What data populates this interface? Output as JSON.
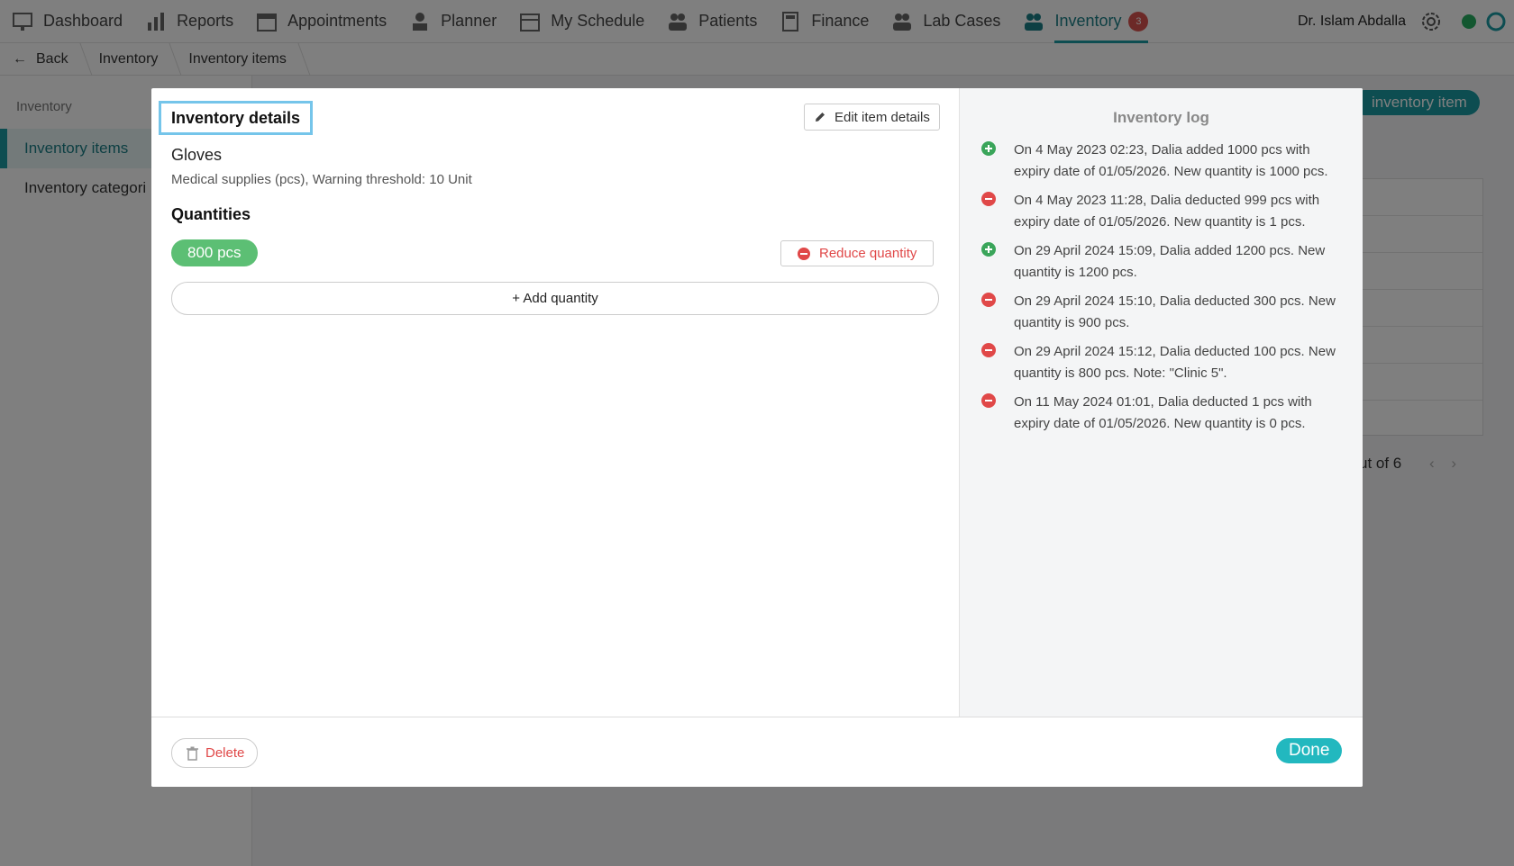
{
  "nav": {
    "items": [
      {
        "label": "Dashboard",
        "icon": "dashboard-icon"
      },
      {
        "label": "Reports",
        "icon": "reports-icon"
      },
      {
        "label": "Appointments",
        "icon": "appointments-icon"
      },
      {
        "label": "Planner",
        "icon": "planner-icon"
      },
      {
        "label": "My Schedule",
        "icon": "schedule-icon"
      },
      {
        "label": "Patients",
        "icon": "patients-icon"
      },
      {
        "label": "Finance",
        "icon": "finance-icon"
      },
      {
        "label": "Lab Cases",
        "icon": "lab-cases-icon"
      },
      {
        "label": "Inventory",
        "icon": "inventory-icon",
        "badge": "3"
      }
    ],
    "user_name": "Dr. Islam Abdalla"
  },
  "breadcrumb": {
    "back": "Back",
    "items": [
      "Inventory",
      "Inventory items"
    ]
  },
  "sidebar": {
    "title": "Inventory",
    "items": [
      "Inventory items",
      "Inventory categori"
    ]
  },
  "background": {
    "add_button": "inventory item",
    "pager": "ut of 6"
  },
  "modal": {
    "details_title": "Inventory details",
    "edit_button": "Edit item details",
    "item_name": "Gloves",
    "item_meta": "Medical supplies (pcs), Warning threshold: 10 Unit",
    "quantities_heading": "Quantities",
    "quantity_pill": "800 pcs",
    "reduce_button": "Reduce quantity",
    "add_quantity": "+ Add quantity",
    "log": {
      "title": "Inventory log",
      "entries": [
        {
          "type": "add",
          "text": "On 4 May 2023 02:23, Dalia added 1000 pcs with expiry date of 01/05/2026. New quantity is 1000 pcs."
        },
        {
          "type": "deduct",
          "text": "On 4 May 2023 11:28, Dalia deducted 999 pcs with expiry date of 01/05/2026. New quantity is 1 pcs."
        },
        {
          "type": "add",
          "text": "On 29 April 2024 15:09, Dalia added 1200 pcs. New quantity is 1200 pcs."
        },
        {
          "type": "deduct",
          "text": "On 29 April 2024 15:10, Dalia deducted 300 pcs. New quantity is 900 pcs."
        },
        {
          "type": "deduct",
          "text": "On 29 April 2024 15:12, Dalia deducted 100 pcs. New quantity is 800 pcs. Note: \"Clinic 5\"."
        },
        {
          "type": "deduct",
          "text": "On 11 May 2024 01:01, Dalia deducted 1 pcs with expiry date of 01/05/2026. New quantity is 0 pcs."
        }
      ]
    },
    "delete_button": "Delete",
    "done_button": "Done"
  },
  "colors": {
    "accent": "#1b9aa3",
    "done": "#22b8bf",
    "danger": "#e04848",
    "success": "#5cbf74",
    "focus_outline": "#75c5ea"
  }
}
